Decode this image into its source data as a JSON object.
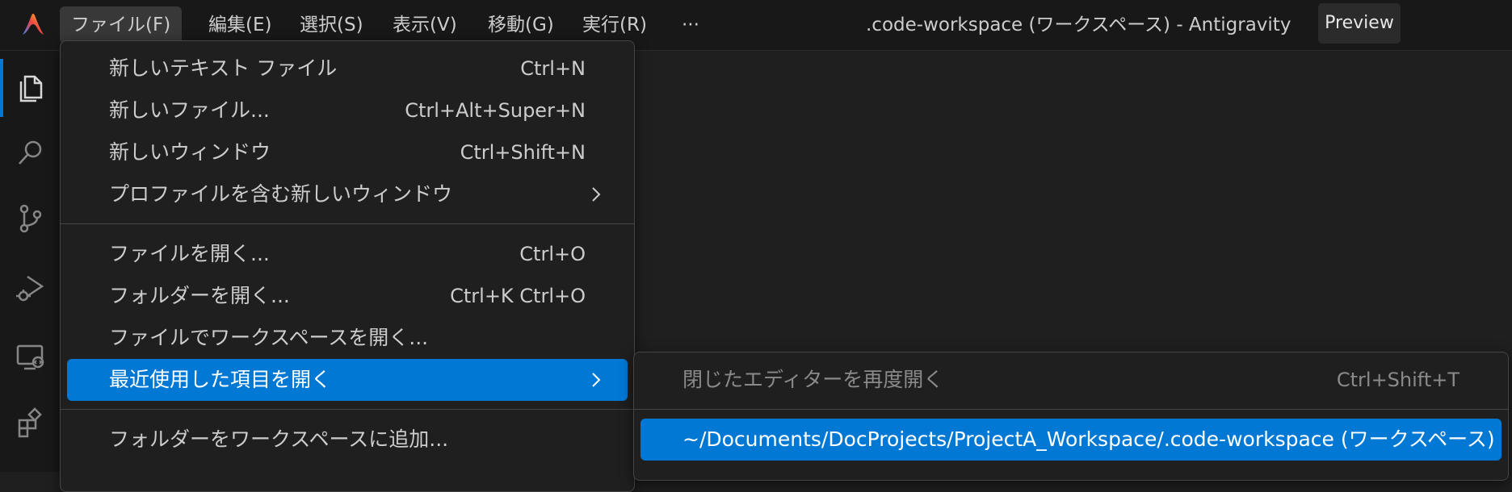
{
  "titlebar": {
    "menus": [
      "ファイル(F)",
      "編集(E)",
      "選択(S)",
      "表示(V)",
      "移動(G)",
      "実行(R)",
      "···"
    ],
    "window_title": ".code-workspace (ワークスペース) - Antigravity",
    "preview_label": "Preview"
  },
  "activity_bar": {
    "items": [
      "explorer-icon",
      "search-icon",
      "source-control-icon",
      "run-debug-icon",
      "remote-explorer-icon",
      "extensions-icon"
    ]
  },
  "file_menu": {
    "items": [
      {
        "label": "新しいテキスト ファイル",
        "shortcut": "Ctrl+N"
      },
      {
        "label": "新しいファイル...",
        "shortcut": "Ctrl+Alt+Super+N"
      },
      {
        "label": "新しいウィンドウ",
        "shortcut": "Ctrl+Shift+N"
      },
      {
        "label": "プロファイルを含む新しいウィンドウ",
        "shortcut": ""
      },
      {
        "label": "ファイルを開く...",
        "shortcut": "Ctrl+O"
      },
      {
        "label": "フォルダーを開く...",
        "shortcut": "Ctrl+K Ctrl+O"
      },
      {
        "label": "ファイルでワークスペースを開く...",
        "shortcut": ""
      },
      {
        "label": "最近使用した項目を開く",
        "shortcut": ""
      },
      {
        "label": "フォルダーをワークスペースに追加...",
        "shortcut": ""
      }
    ]
  },
  "recent_submenu": {
    "items": [
      {
        "label": "閉じたエディターを再度開く",
        "shortcut": "Ctrl+Shift+T"
      },
      {
        "label": "~/Documents/DocProjects/ProjectA_Workspace/.code-workspace (ワークスペース)",
        "shortcut": ""
      }
    ]
  },
  "colors": {
    "accent": "#0078d4",
    "background": "#1f1f1f",
    "titlebar": "#181818"
  }
}
